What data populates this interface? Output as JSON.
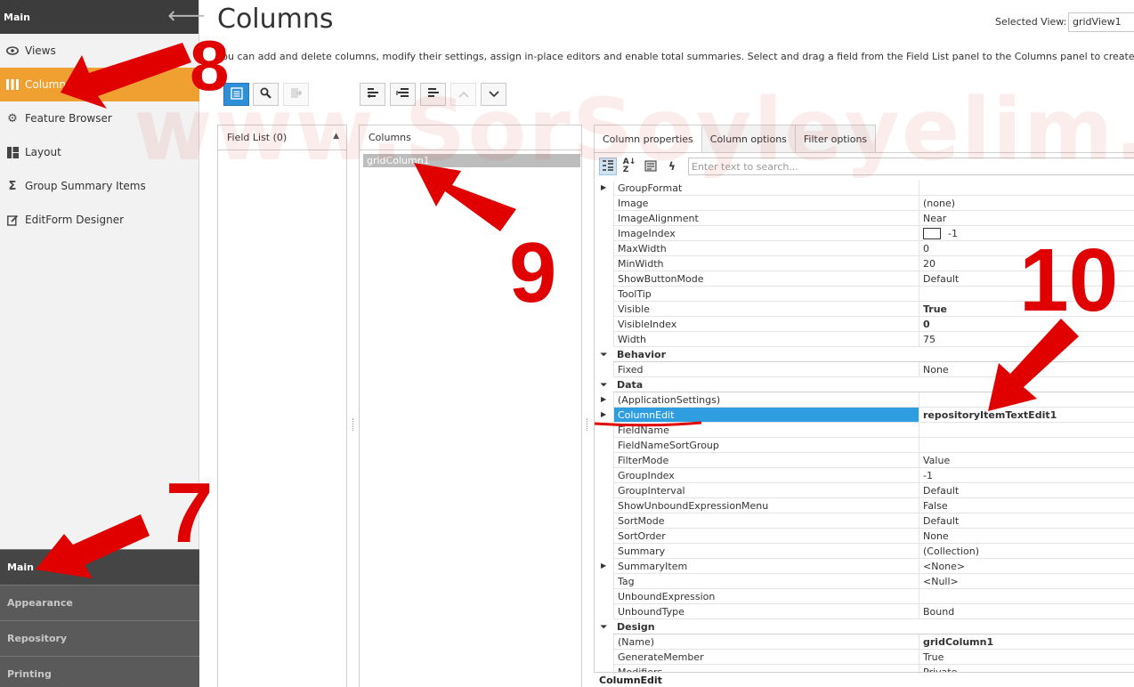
{
  "sidebar": {
    "header": "Main",
    "items": [
      {
        "label": "Views",
        "icon": "eye-icon"
      },
      {
        "label": "Columns",
        "icon": "columns-icon"
      },
      {
        "label": "Feature Browser",
        "icon": "gear-icon"
      },
      {
        "label": "Layout",
        "icon": "layout-icon"
      },
      {
        "label": "Group Summary Items",
        "icon": "sigma-icon"
      },
      {
        "label": "EditForm Designer",
        "icon": "edit-form-icon"
      }
    ],
    "bottom_groups": [
      "Main",
      "Appearance",
      "Repository",
      "Printing"
    ]
  },
  "page": {
    "title": "Columns",
    "selected_view_label": "Selected View:",
    "selected_view_value": "gridView1",
    "description": "You can add and delete columns, modify their settings, assign in-place editors and enable total summaries. Select and drag a field from the Field List panel to the Columns panel to create a co"
  },
  "field_list": {
    "header": "Field List (0)"
  },
  "columns_panel": {
    "header": "Columns",
    "items": [
      "gridColumn1"
    ]
  },
  "tabs": [
    "Column properties",
    "Column options",
    "Filter options"
  ],
  "search": {
    "placeholder": "Enter text to search..."
  },
  "properties": [
    {
      "name": "GroupFormat",
      "value": "",
      "expander": "collapsed"
    },
    {
      "name": "Image",
      "value": "(none)"
    },
    {
      "name": "ImageAlignment",
      "value": "Near"
    },
    {
      "name": "ImageIndex",
      "value": "-1",
      "swatch": true
    },
    {
      "name": "MaxWidth",
      "value": "0"
    },
    {
      "name": "MinWidth",
      "value": "20"
    },
    {
      "name": "ShowButtonMode",
      "value": "Default"
    },
    {
      "name": "ToolTip",
      "value": ""
    },
    {
      "name": "Visible",
      "value": "True",
      "bold": true
    },
    {
      "name": "VisibleIndex",
      "value": "0",
      "bold": true
    },
    {
      "name": "Width",
      "value": "75"
    },
    {
      "name": "Behavior",
      "category": true
    },
    {
      "name": "Fixed",
      "value": "None"
    },
    {
      "name": "Data",
      "category": true
    },
    {
      "name": "(ApplicationSettings)",
      "value": "",
      "expander": "collapsed"
    },
    {
      "name": "ColumnEdit",
      "value": "repositoryItemTextEdit1",
      "bold": true,
      "selected": true,
      "expander": "collapsed"
    },
    {
      "name": "FieldName",
      "value": ""
    },
    {
      "name": "FieldNameSortGroup",
      "value": ""
    },
    {
      "name": "FilterMode",
      "value": "Value"
    },
    {
      "name": "GroupIndex",
      "value": "-1"
    },
    {
      "name": "GroupInterval",
      "value": "Default"
    },
    {
      "name": "ShowUnboundExpressionMenu",
      "value": "False"
    },
    {
      "name": "SortMode",
      "value": "Default"
    },
    {
      "name": "SortOrder",
      "value": "None"
    },
    {
      "name": "Summary",
      "value": "(Collection)"
    },
    {
      "name": "SummaryItem",
      "value": "<None>",
      "expander": "collapsed"
    },
    {
      "name": "Tag",
      "value": "<Null>"
    },
    {
      "name": "UnboundExpression",
      "value": ""
    },
    {
      "name": "UnboundType",
      "value": "Bound"
    },
    {
      "name": "Design",
      "category": true
    },
    {
      "name": "(Name)",
      "value": "gridColumn1",
      "bold": true
    },
    {
      "name": "GenerateMember",
      "value": "True"
    },
    {
      "name": "Modifiers",
      "value": "Private"
    }
  ],
  "footer": {
    "selected_property": "ColumnEdit"
  },
  "annotations": {
    "watermark": "www.SorSoyleyelim.com",
    "numbers": [
      "7",
      "8",
      "9",
      "10"
    ],
    "color": "#e00000"
  },
  "colors": {
    "accent": "#f0a030",
    "selection": "#2f9ee0",
    "primary_button": "#2f8fd8"
  }
}
